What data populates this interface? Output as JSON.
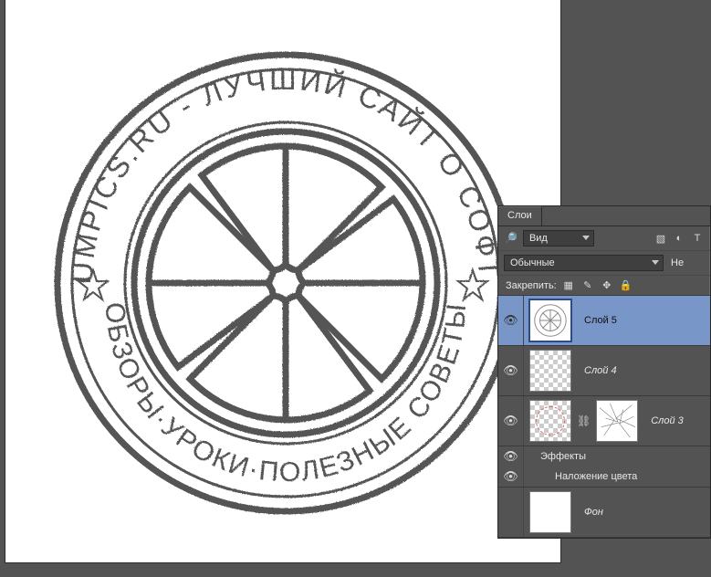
{
  "panel": {
    "title": "Слои",
    "filter_label": "Вид",
    "blend_mode": "Обычные",
    "opacity_label": "Не",
    "lock_label": "Закрепить:"
  },
  "layers": {
    "l5": {
      "name": "Слой 5"
    },
    "l4": {
      "name": "Слой 4"
    },
    "l3": {
      "name": "Слой 3"
    },
    "fx": {
      "title": "Эффекты",
      "overlay": "Наложение цвета"
    },
    "bg": {
      "name": "Фон"
    }
  },
  "stamp": {
    "top_text": "LUMPICS.RU - ЛУЧШИЙ САЙТ О СОФТЕ",
    "bottom_text": "ОБЗОРЫ·УРОКИ·ПОЛЕЗНЫЕ СОВЕТЫ"
  }
}
